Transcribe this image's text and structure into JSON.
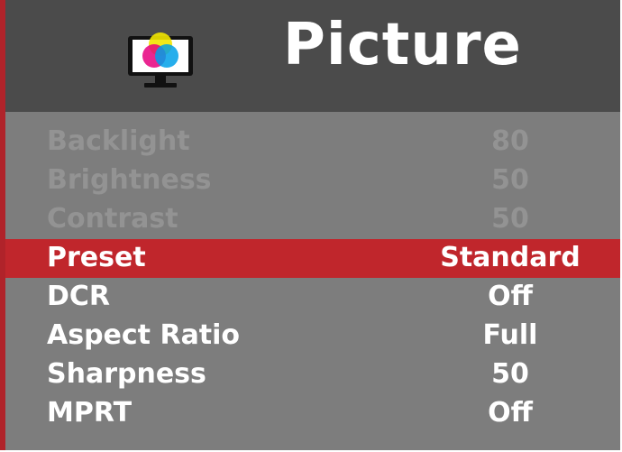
{
  "header": {
    "title": "Picture",
    "icon": "monitor-color-icon"
  },
  "menu": {
    "items": [
      {
        "label": "Backlight",
        "value": "80",
        "state": "disabled"
      },
      {
        "label": "Brightness",
        "value": "50",
        "state": "disabled"
      },
      {
        "label": "Contrast",
        "value": "50",
        "state": "disabled"
      },
      {
        "label": "Preset",
        "value": "Standard",
        "state": "selected"
      },
      {
        "label": "DCR",
        "value": "Off",
        "state": "enabled"
      },
      {
        "label": "Aspect Ratio",
        "value": "Full",
        "state": "enabled"
      },
      {
        "label": "Sharpness",
        "value": "50",
        "state": "enabled"
      },
      {
        "label": "MPRT",
        "value": "Off",
        "state": "enabled"
      }
    ]
  },
  "colors": {
    "accent": "#c0262c",
    "header_bg": "#4b4b4b",
    "panel_bg": "#7d7d7d",
    "disabled_text": "#939393",
    "text": "#ffffff"
  }
}
